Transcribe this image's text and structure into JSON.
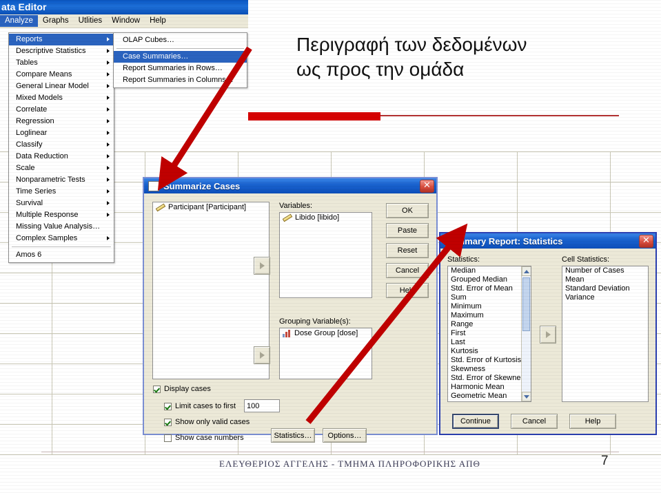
{
  "slide": {
    "title_line1": "Περιγραφή των δεδομένων",
    "title_line2": "ως προς την ομάδα",
    "footer": "ΕΛΕΥΘΕΡΙΟΣ ΑΓΓΕΛΗΣ - ΤΜΗΜΑ ΠΛΗΡΟΦΟΡΙΚΗΣ ΑΠΘ",
    "page_number": "7",
    "accent_color": "#d60000",
    "rule_thin_color": "#b03030"
  },
  "spss_window": {
    "title": "ata Editor",
    "menubar": [
      {
        "label": "Analyze",
        "selected": true
      },
      {
        "label": "Graphs",
        "selected": false
      },
      {
        "label": "Utlities",
        "selected": false
      },
      {
        "label": "Window",
        "selected": false
      },
      {
        "label": "Help",
        "selected": false
      }
    ]
  },
  "analyze_menu": {
    "items": [
      {
        "label": "Reports",
        "submenu": true,
        "selected": true
      },
      {
        "label": "Descriptive Statistics",
        "submenu": true,
        "selected": false
      },
      {
        "label": "Tables",
        "submenu": true,
        "selected": false
      },
      {
        "label": "Compare Means",
        "submenu": true,
        "selected": false
      },
      {
        "label": "General Linear Model",
        "submenu": true,
        "selected": false
      },
      {
        "label": "Mixed Models",
        "submenu": true,
        "selected": false
      },
      {
        "label": "Correlate",
        "submenu": true,
        "selected": false
      },
      {
        "label": "Regression",
        "submenu": true,
        "selected": false
      },
      {
        "label": "Loglinear",
        "submenu": true,
        "selected": false
      },
      {
        "label": "Classify",
        "submenu": true,
        "selected": false
      },
      {
        "label": "Data Reduction",
        "submenu": true,
        "selected": false
      },
      {
        "label": "Scale",
        "submenu": true,
        "selected": false
      },
      {
        "label": "Nonparametric Tests",
        "submenu": true,
        "selected": false
      },
      {
        "label": "Time Series",
        "submenu": true,
        "selected": false
      },
      {
        "label": "Survival",
        "submenu": true,
        "selected": false
      },
      {
        "label": "Multiple Response",
        "submenu": true,
        "selected": false
      },
      {
        "label": "Missing Value Analysis…",
        "submenu": false,
        "selected": false
      },
      {
        "label": "Complex Samples",
        "submenu": true,
        "selected": false
      }
    ],
    "after_separator_item": "Amos 6"
  },
  "reports_submenu": {
    "items": [
      {
        "label": "OLAP Cubes…",
        "selected": false
      },
      {
        "label": "Case Summaries…",
        "selected": true
      },
      {
        "label": "Report Summaries in Rows…",
        "selected": false
      },
      {
        "label": "Report Summaries in Columns…",
        "selected": false
      }
    ]
  },
  "summarize_cases_dialog": {
    "title": "Summarize Cases",
    "close_glyph": "✕",
    "source_list": [
      {
        "label": "Participant [Participant]",
        "icon": "scale-ruler-icon"
      }
    ],
    "variables_label": "Variables:",
    "variables_list": [
      {
        "label": "Libido [libido]",
        "icon": "scale-ruler-icon"
      }
    ],
    "grouping_label": "Grouping Variable(s):",
    "grouping_list": [
      {
        "label": "Dose Group [dose]",
        "icon": "nominal-bars-icon"
      }
    ],
    "buttons": [
      "OK",
      "Paste",
      "Reset",
      "Cancel",
      "Help"
    ],
    "checkboxes": [
      {
        "label": "Display cases",
        "checked": true
      },
      {
        "label": "Limit cases to first",
        "checked": true
      },
      {
        "label": "Show only valid cases",
        "checked": true
      },
      {
        "label": "Show case numbers",
        "checked": false
      }
    ],
    "limit_value": "100",
    "bottom_buttons": [
      "Statistics…",
      "Options…"
    ]
  },
  "summary_report_statistics_dialog": {
    "title": "Summary Report: Statistics",
    "close_glyph": "✕",
    "statistics_label": "Statistics:",
    "statistics_list": [
      "Median",
      "Grouped Median",
      "Std. Error of Mean",
      "Sum",
      "Minimum",
      "Maximum",
      "Range",
      "First",
      "Last",
      "Kurtosis",
      "Std. Error of Kurtosis",
      "Skewness",
      "Std. Error of Skewne",
      "Harmonic Mean",
      "Geometric Mean"
    ],
    "cell_statistics_label": "Cell Statistics:",
    "cell_statistics_list": [
      "Number of Cases",
      "Mean",
      "Standard Deviation",
      "Variance"
    ],
    "buttons": [
      "Continue",
      "Cancel",
      "Help"
    ]
  },
  "annotations": {
    "arrow_color": "#c00000",
    "arrow1_label": "arrow-case-summaries-to-dialog",
    "arrow2_label": "arrow-statistics-button-to-dialog"
  }
}
